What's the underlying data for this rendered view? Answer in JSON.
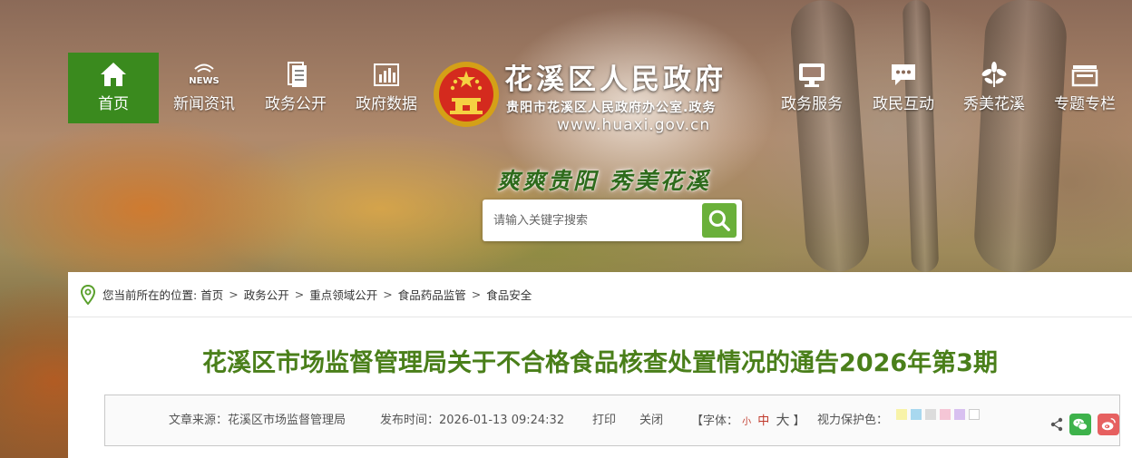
{
  "nav": {
    "items": [
      {
        "label": "首页",
        "icon": "home-icon",
        "active": true
      },
      {
        "label": "新闻资讯",
        "icon": "news-icon"
      },
      {
        "label": "政务公开",
        "icon": "document-icon"
      },
      {
        "label": "政府数据",
        "icon": "bar-chart-icon"
      },
      {
        "label": "政务服务",
        "icon": "monitor-icon"
      },
      {
        "label": "政民互动",
        "icon": "chat-bubble-icon"
      },
      {
        "label": "秀美花溪",
        "icon": "flower-icon"
      },
      {
        "label": "专题专栏",
        "icon": "folder-icon"
      }
    ],
    "news_badge": "NEWS"
  },
  "header": {
    "title": "花溪区人民政府",
    "subtitle": "贵阳市花溪区人民政府办公室.政务",
    "url": "www.huaxi.gov.cn",
    "slogan": "爽爽贵阳  秀美花溪"
  },
  "search": {
    "placeholder": "请输入关键字搜索"
  },
  "breadcrumb": {
    "prefix": "您当前所在的位置:",
    "items": [
      "首页",
      "政务公开",
      "重点领域公开",
      "食品药品监管",
      "食品安全"
    ],
    "separator": ">"
  },
  "article": {
    "title": "花溪区市场监督管理局关于不合格食品核查处置情况的通告2026年第3期",
    "source_label": "文章来源：",
    "source": "花溪区市场监督管理局",
    "time_label": "发布时间：",
    "time": "2026-01-13 09:24:32",
    "print": "打印",
    "close": "关闭",
    "font_label": "【字体：",
    "font_small": "小",
    "font_medium": "中",
    "font_large": "大",
    "font_end": "】",
    "eye_label": "视力保护色：",
    "eye_colors": [
      "#f8f3a8",
      "#a8d8ef",
      "#dcdcdc",
      "#f5c6d6",
      "#d8c0f0",
      "#ffffff"
    ]
  },
  "colors": {
    "accent_green": "#3a8a1e",
    "title_green": "#4a7f1a",
    "search_green": "#6ab03a"
  }
}
